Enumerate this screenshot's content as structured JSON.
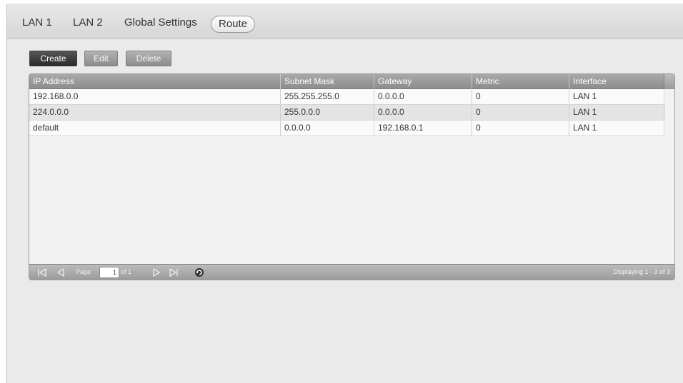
{
  "tabs": [
    {
      "label": "LAN 1",
      "active": false
    },
    {
      "label": "LAN 2",
      "active": false
    },
    {
      "label": "Global Settings",
      "active": false
    },
    {
      "label": "Route",
      "active": true
    }
  ],
  "toolbar": {
    "create_label": "Create",
    "edit_label": "Edit",
    "delete_label": "Delete"
  },
  "grid": {
    "columns": [
      "IP Address",
      "Subnet Mask",
      "Gateway",
      "Metric",
      "Interface"
    ],
    "rows": [
      [
        "192.168.0.0",
        "255.255.255.0",
        "0.0.0.0",
        "0",
        "LAN 1"
      ],
      [
        "224.0.0.0",
        "255.0.0.0",
        "0.0.0.0",
        "0",
        "LAN 1"
      ],
      [
        "default",
        "0.0.0.0",
        "192.168.0.1",
        "0",
        "LAN 1"
      ]
    ]
  },
  "pager": {
    "page_label": "Page",
    "current_page": "1",
    "of_label": "of 1",
    "display_text": "Displaying 1 - 3 of 3",
    "icons": [
      "first-page-icon",
      "prev-page-icon",
      "next-page-icon",
      "last-page-icon",
      "refresh-icon"
    ]
  },
  "colors": {
    "header_bg": "#9a9a9a",
    "create_bg": "#3a3a3a",
    "row_alt": "#e4e4e4"
  }
}
